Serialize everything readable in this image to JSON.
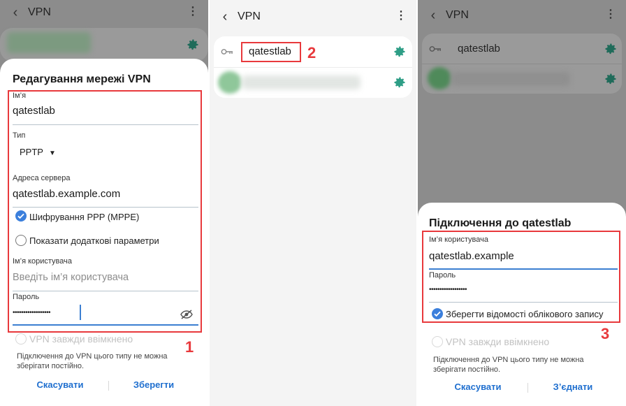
{
  "panel1": {
    "appbar": {
      "title": "VPN"
    },
    "dialog": {
      "title": "Редагування мережі VPN",
      "name_label": "Ім’я",
      "name_value": "qatestlab",
      "type_label": "Тип",
      "type_value": "PPTP",
      "server_label": "Адреса сервера",
      "server_value": "qatestlab.example.com",
      "encryption_label": "Шифрування PPP (MPPE)",
      "advanced_label": "Показати додаткові параметри",
      "username_label": "Ім’я користувача",
      "username_placeholder": "Введіть ім’я користувача",
      "password_label": "Пароль",
      "password_value": "••••••••••••••••••",
      "always_on_label": "VPN завжди ввімкнено",
      "note": "Підключення до VPN цього типу не можна зберігати постійно.",
      "cancel_button": "Скасувати",
      "save_button": "Зберегти"
    },
    "marker": "1"
  },
  "panel2": {
    "appbar": {
      "title": "VPN"
    },
    "vpn_item": "qatestlab",
    "marker": "2"
  },
  "panel3": {
    "appbar": {
      "title": "VPN"
    },
    "vpn_item": "qatestlab",
    "dialog": {
      "title": "Підключення до qatestlab",
      "username_label": "Ім’я користувача",
      "username_value": "qatestlab.example",
      "password_label": "Пароль",
      "password_value": "••••••••••••••••••",
      "save_credentials_label": "Зберегти відомості облікового запису",
      "always_on_label": "VPN завжди ввімкнено",
      "note": "Підключення до VPN цього типу не можна зберігати постійно.",
      "cancel_button": "Скасувати",
      "connect_button": "З’єднати"
    },
    "marker": "3"
  },
  "colors": {
    "accent": "#3b7fdc",
    "annotation": "#e8393c",
    "gear": "#2e9e86"
  },
  "icons": [
    "back-icon",
    "kebab-icon",
    "gear-icon",
    "key-icon",
    "dropdown-icon",
    "eye-off-icon",
    "check-icon"
  ]
}
